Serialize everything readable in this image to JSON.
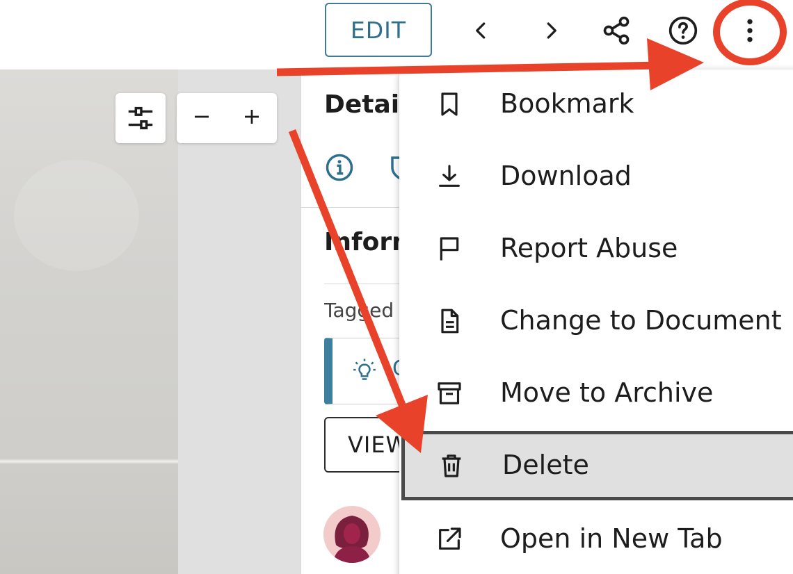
{
  "toolbar": {
    "edit_label": "EDIT",
    "icons": [
      "chevron-left-icon",
      "chevron-right-icon",
      "share-icon",
      "help-icon",
      "more-vertical-icon"
    ]
  },
  "viewer": {
    "controls": [
      "adjust-sliders-icon",
      "zoom-out-icon",
      "zoom-in-icon"
    ]
  },
  "details": {
    "title": "Details",
    "info_title": "Information",
    "tagged_label": "Tagged",
    "tag_text": "C",
    "view_label": "VIEW"
  },
  "menu": {
    "items": [
      {
        "label": "Bookmark",
        "icon": "bookmark-icon"
      },
      {
        "label": "Download",
        "icon": "download-icon"
      },
      {
        "label": "Report Abuse",
        "icon": "flag-icon"
      },
      {
        "label": "Change to Document",
        "icon": "document-icon"
      },
      {
        "label": "Move to Archive",
        "icon": "archive-icon"
      },
      {
        "label": "Delete",
        "icon": "trash-icon",
        "selected": true
      },
      {
        "label": "Open in New Tab",
        "icon": "external-link-icon"
      }
    ]
  },
  "colors": {
    "accent": "#2f6f8e",
    "annotation": "#e8432a",
    "selected_bg": "#dfe0df"
  }
}
